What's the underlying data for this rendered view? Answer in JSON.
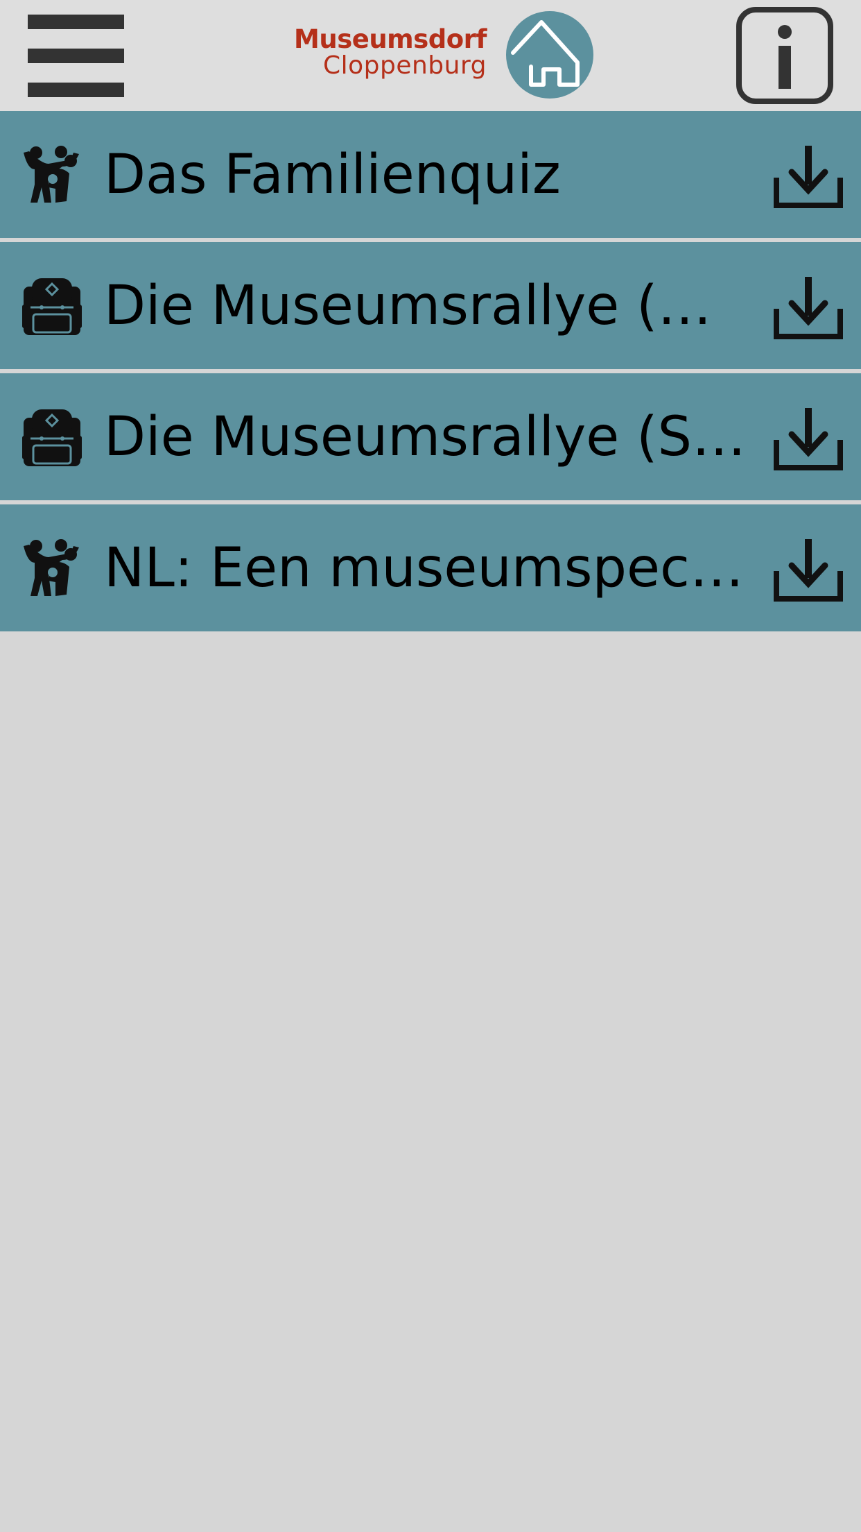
{
  "colors": {
    "header_bg": "#dedede",
    "page_bg": "#d6d6d6",
    "list_item_bg": "#5c919e",
    "brand_red": "#b5301a",
    "home_circle": "#5c919e",
    "icon_dark": "#111111"
  },
  "header": {
    "menu_icon": "hamburger-menu-icon",
    "logo": {
      "line1": "Museumsdorf",
      "line2": "Cloppenburg",
      "icon": "home-icon"
    },
    "info_icon": "info-icon"
  },
  "tours": [
    {
      "label": "Das Familienquiz",
      "icon": "family-icon",
      "action_icon": "download-icon"
    },
    {
      "label": "Die Museumsrallye (Gr…",
      "icon": "backpack-icon",
      "action_icon": "download-icon"
    },
    {
      "label": "Die Museumsrallye (Se…",
      "icon": "backpack-icon",
      "action_icon": "download-icon"
    },
    {
      "label": "NL: Een museumspeci…",
      "icon": "family-icon",
      "action_icon": "download-icon"
    }
  ]
}
